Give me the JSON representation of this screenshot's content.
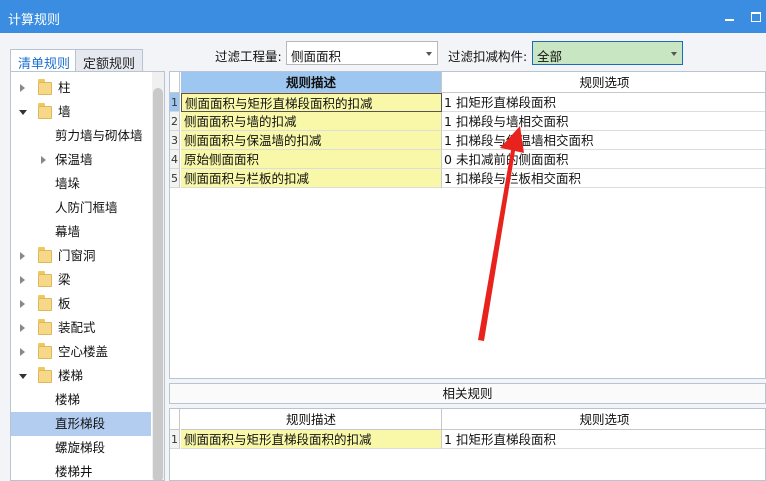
{
  "window": {
    "title": "计算规则"
  },
  "tabs": [
    {
      "label": "清单规则",
      "active": true
    },
    {
      "label": "定额规则",
      "active": false
    }
  ],
  "filters": {
    "quantity_label": "过滤工程量:",
    "quantity_value": "侧面面积",
    "deduct_label": "过滤扣减构件:",
    "deduct_value": "全部"
  },
  "tree": [
    {
      "label": "柱",
      "level": 0,
      "expander": "collapsed",
      "icon": "folder-icon"
    },
    {
      "label": "墙",
      "level": 0,
      "expander": "expanded",
      "icon": "folder-icon"
    },
    {
      "label": "剪力墙与砌体墙",
      "level": 1
    },
    {
      "label": "保温墙",
      "level": 1,
      "expander": "collapsed"
    },
    {
      "label": "墙垛",
      "level": 1
    },
    {
      "label": "人防门框墙",
      "level": 1
    },
    {
      "label": "幕墙",
      "level": 1
    },
    {
      "label": "门窗洞",
      "level": 0,
      "expander": "collapsed",
      "icon": "folder-icon"
    },
    {
      "label": "梁",
      "level": 0,
      "expander": "collapsed",
      "icon": "folder-icon"
    },
    {
      "label": "板",
      "level": 0,
      "expander": "collapsed",
      "icon": "folder-icon"
    },
    {
      "label": "装配式",
      "level": 0,
      "expander": "collapsed",
      "icon": "folder-icon"
    },
    {
      "label": "空心楼盖",
      "level": 0,
      "expander": "collapsed",
      "icon": "folder-icon"
    },
    {
      "label": "楼梯",
      "level": 0,
      "expander": "expanded",
      "icon": "folder-icon"
    },
    {
      "label": "楼梯",
      "level": 1
    },
    {
      "label": "直形梯段",
      "level": 1,
      "selected": true
    },
    {
      "label": "螺旋梯段",
      "level": 1
    },
    {
      "label": "楼梯井",
      "level": 1
    }
  ],
  "rules_table": {
    "headers": [
      "规则描述",
      "规则选项"
    ],
    "rows": [
      {
        "num": "1",
        "desc": "侧面面积与矩形直梯段面积的扣减",
        "code": "1",
        "option": "扣矩形直梯段面积"
      },
      {
        "num": "2",
        "desc": "侧面面积与墙的扣减",
        "code": "1",
        "option": "扣梯段与墙相交面积"
      },
      {
        "num": "3",
        "desc": "侧面面积与保温墙的扣减",
        "code": "1",
        "option": "扣梯段与保温墙相交面积"
      },
      {
        "num": "4",
        "desc": "原始侧面面积",
        "code": "0",
        "option": "未扣减前的侧面面积"
      },
      {
        "num": "5",
        "desc": "侧面面积与栏板的扣减",
        "code": "1",
        "option": "扣梯段与栏板相交面积"
      }
    ]
  },
  "related": {
    "label": "相关规则",
    "headers": [
      "规则描述",
      "规则选项"
    ],
    "rows": [
      {
        "num": "1",
        "desc": "侧面面积与矩形直梯段面积的扣减",
        "code": "1",
        "option": "扣矩形直梯段面积"
      }
    ]
  },
  "colors": {
    "titlebar": "#3a8de0",
    "header_highlight": "#9dc6f0",
    "desc_cell": "#f8f8a8",
    "selected_tree": "#b3cdf0",
    "deduct_select": "#c9e6c3",
    "annotation_arrow": "#e8231d"
  }
}
